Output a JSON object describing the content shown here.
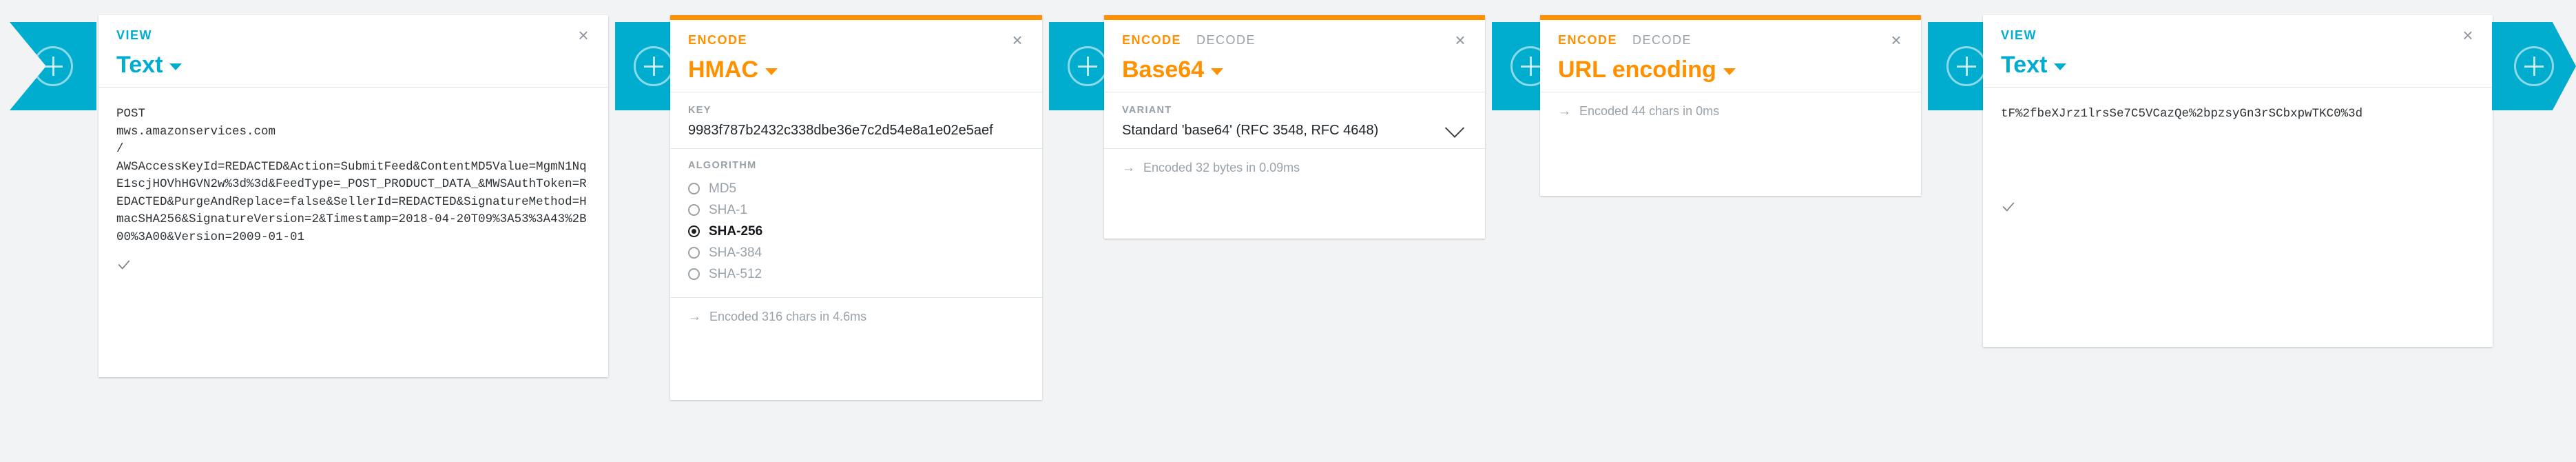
{
  "theme": {
    "teal": "#00ADCE",
    "orange": "#FF9000",
    "page_bg": "#f1f3f5",
    "card_bg": "#ffffff",
    "muted_text": "#9aa2a9"
  },
  "connectors": [
    {
      "icon": "plus-circle-icon",
      "shape": "chevron-start"
    },
    {
      "icon": "plus-circle-icon",
      "shape": "rectangle"
    },
    {
      "icon": "plus-circle-icon",
      "shape": "rectangle"
    },
    {
      "icon": "plus-circle-icon",
      "shape": "rectangle"
    },
    {
      "icon": "plus-circle-icon",
      "shape": "rectangle"
    },
    {
      "icon": "plus-circle-icon",
      "shape": "chevron-end"
    }
  ],
  "cards": [
    {
      "id": "view-input",
      "modes": [
        {
          "label": "VIEW",
          "state": "active-view"
        }
      ],
      "close_label": "×",
      "operation": "Text",
      "caret_icon": "caret-down-icon",
      "content": "POST\nmws.amazonservices.com\n/\nAWSAccessKeyId=REDACTED&Action=SubmitFeed&ContentMD5Value=MgmN1NqE1scjHOVhHGVN2w%3d%3d&FeedType=_POST_PRODUCT_DATA_&MWSAuthToken=REDACTED&PurgeAndReplace=false&SellerId=REDACTED&SignatureMethod=HmacSHA256&SignatureVersion=2&Timestamp=2018-04-20T09%3A53%3A43%2B00%3A00&Version=2009-01-01",
      "footer_icon": "check-icon"
    },
    {
      "id": "hmac",
      "modes": [
        {
          "label": "ENCODE",
          "state": "active-encode"
        }
      ],
      "close_label": "×",
      "operation": "HMAC",
      "caret_icon": "caret-down-icon",
      "key_label": "KEY",
      "key_value": "9983f787b2432c338dbe36e7c2d54e8a1e02e5aef",
      "algorithm_label": "ALGORITHM",
      "algorithms": [
        {
          "label": "MD5",
          "selected": false
        },
        {
          "label": "SHA-1",
          "selected": false
        },
        {
          "label": "SHA-256",
          "selected": true
        },
        {
          "label": "SHA-384",
          "selected": false
        },
        {
          "label": "SHA-512",
          "selected": false
        }
      ],
      "status": "Encoded 316 chars in 4.6ms",
      "status_icon": "arrow-right-icon"
    },
    {
      "id": "base64",
      "modes": [
        {
          "label": "ENCODE",
          "state": "active-encode"
        },
        {
          "label": "DECODE",
          "state": "inactive"
        }
      ],
      "close_label": "×",
      "operation": "Base64",
      "caret_icon": "caret-down-icon",
      "variant_label": "VARIANT",
      "variant_value": "Standard 'base64' (RFC 3548, RFC 4648)",
      "variant_icon": "chevron-down-icon",
      "status": "Encoded 32 bytes in 0.09ms",
      "status_icon": "arrow-right-icon"
    },
    {
      "id": "url-encoding",
      "modes": [
        {
          "label": "ENCODE",
          "state": "active-encode"
        },
        {
          "label": "DECODE",
          "state": "inactive"
        }
      ],
      "close_label": "×",
      "operation": "URL encoding",
      "caret_icon": "caret-down-icon",
      "status": "Encoded 44 chars in 0ms",
      "status_icon": "arrow-right-icon"
    },
    {
      "id": "view-output",
      "modes": [
        {
          "label": "VIEW",
          "state": "active-view"
        }
      ],
      "close_label": "×",
      "operation": "Text",
      "caret_icon": "caret-down-icon",
      "content": "tF%2fbeXJrz1lrsSe7C5VCazQe%2bpzsyGn3rSCbxpwTKC0%3d",
      "footer_icon": "check-icon"
    }
  ]
}
